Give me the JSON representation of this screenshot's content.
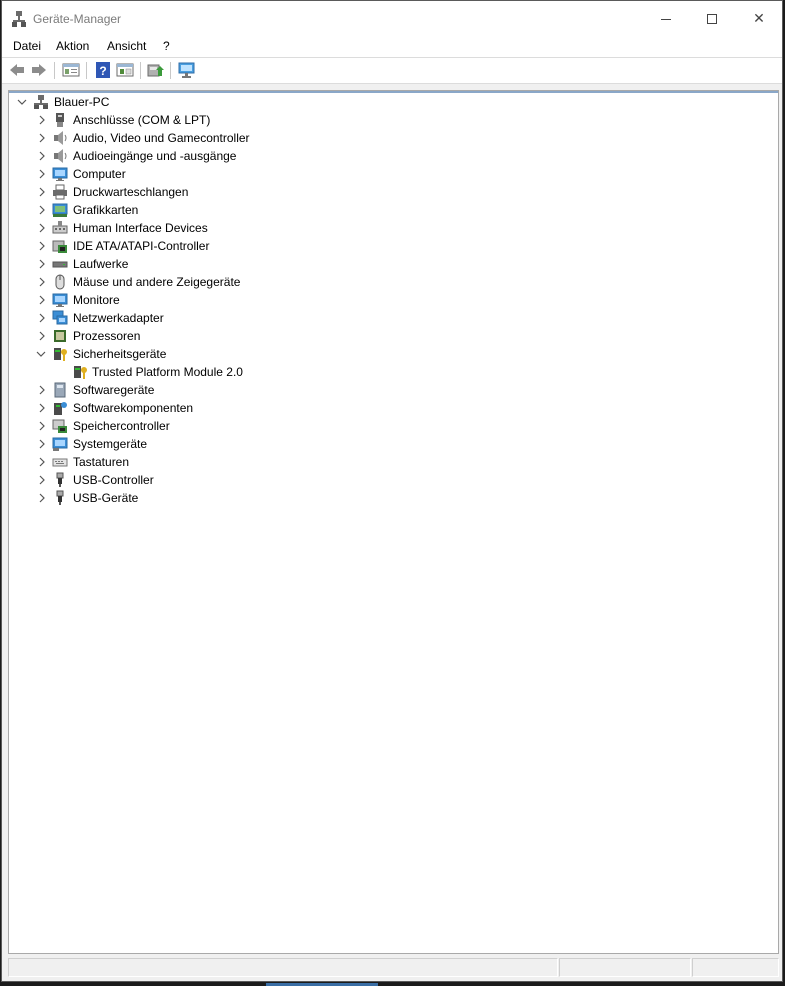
{
  "window": {
    "title": "Geräte-Manager"
  },
  "menu": {
    "file": "Datei",
    "action": "Aktion",
    "view": "Ansicht",
    "help": "?"
  },
  "tree": {
    "root": "Blauer-PC",
    "items": [
      {
        "label": "Anschlüsse (COM & LPT)",
        "icon": "ports-icon",
        "expanded": false
      },
      {
        "label": "Audio, Video und Gamecontroller",
        "icon": "speaker-icon",
        "expanded": false
      },
      {
        "label": "Audioeingänge und -ausgänge",
        "icon": "speaker-icon",
        "expanded": false
      },
      {
        "label": "Computer",
        "icon": "computer-icon",
        "expanded": false
      },
      {
        "label": "Druckwarteschlangen",
        "icon": "printer-icon",
        "expanded": false
      },
      {
        "label": "Grafikkarten",
        "icon": "display-adapter-icon",
        "expanded": false
      },
      {
        "label": "Human Interface Devices",
        "icon": "hid-icon",
        "expanded": false
      },
      {
        "label": "IDE ATA/ATAPI-Controller",
        "icon": "ide-controller-icon",
        "expanded": false
      },
      {
        "label": "Laufwerke",
        "icon": "disk-drive-icon",
        "expanded": false
      },
      {
        "label": "Mäuse und andere Zeigegeräte",
        "icon": "mouse-icon",
        "expanded": false
      },
      {
        "label": "Monitore",
        "icon": "monitor-icon",
        "expanded": false
      },
      {
        "label": "Netzwerkadapter",
        "icon": "network-adapter-icon",
        "expanded": false
      },
      {
        "label": "Prozessoren",
        "icon": "processor-icon",
        "expanded": false
      },
      {
        "label": "Sicherheitsgeräte",
        "icon": "security-device-icon",
        "expanded": true
      },
      {
        "label": "Trusted Platform Module 2.0",
        "icon": "security-device-icon",
        "child": true
      },
      {
        "label": "Softwaregeräte",
        "icon": "software-device-icon",
        "expanded": false
      },
      {
        "label": "Softwarekomponenten",
        "icon": "software-component-icon",
        "expanded": false
      },
      {
        "label": "Speichercontroller",
        "icon": "storage-controller-icon",
        "expanded": false
      },
      {
        "label": "Systemgeräte",
        "icon": "system-device-icon",
        "expanded": false
      },
      {
        "label": "Tastaturen",
        "icon": "keyboard-icon",
        "expanded": false
      },
      {
        "label": "USB-Controller",
        "icon": "usb-icon",
        "expanded": false
      },
      {
        "label": "USB-Geräte",
        "icon": "usb-icon",
        "expanded": false
      }
    ]
  },
  "colors": {
    "accent": "#3a6ea5",
    "selection_line": "#8aa7c8",
    "title_text": "#7a7a7a"
  }
}
